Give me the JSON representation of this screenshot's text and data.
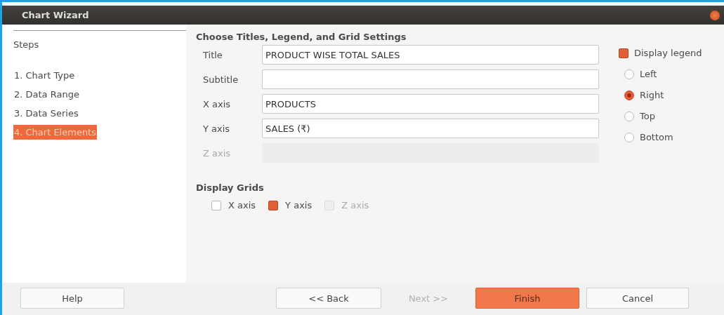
{
  "window": {
    "title": "Chart Wizard"
  },
  "steps": {
    "heading": "Steps",
    "items": [
      {
        "label": "1. Chart Type",
        "selected": false
      },
      {
        "label": "2. Data Range",
        "selected": false
      },
      {
        "label": "3. Data Series",
        "selected": false
      },
      {
        "label": "4. Chart Elements",
        "selected": true
      }
    ]
  },
  "section_title": "Choose Titles, Legend, and Grid Settings",
  "fields": [
    {
      "label": "Title",
      "value": "PRODUCT WISE TOTAL SALES",
      "disabled": false
    },
    {
      "label": "Subtitle",
      "disabled": false
    },
    {
      "label": "X axis",
      "value": "PRODUCTS",
      "disabled": false
    },
    {
      "label": "Y axis",
      "value": "SALES (₹)",
      "disabled": false
    },
    {
      "label": "Z axis",
      "disabled": true
    }
  ],
  "legend": {
    "label": "Display legend",
    "checked": true,
    "positions": [
      {
        "label": "Left",
        "selected": false
      },
      {
        "label": "Right",
        "selected": true
      },
      {
        "label": "Top",
        "selected": false
      },
      {
        "label": "Bottom",
        "selected": false
      }
    ]
  },
  "grids": {
    "heading": "Display Grids",
    "items": [
      {
        "label": "X axis",
        "checked": false,
        "disabled": false
      },
      {
        "label": "Y axis",
        "checked": true,
        "disabled": false
      },
      {
        "label": "Z axis",
        "checked": false,
        "disabled": true
      }
    ]
  },
  "buttons": [
    {
      "label": "Help",
      "disabled": false,
      "default": false
    },
    {
      "label": "<< Back",
      "disabled": false,
      "default": false
    },
    {
      "label": "Next >>",
      "disabled": true,
      "default": false
    },
    {
      "label": "Finish",
      "disabled": false,
      "default": true
    },
    {
      "label": "Cancel",
      "disabled": false,
      "default": false
    }
  ]
}
